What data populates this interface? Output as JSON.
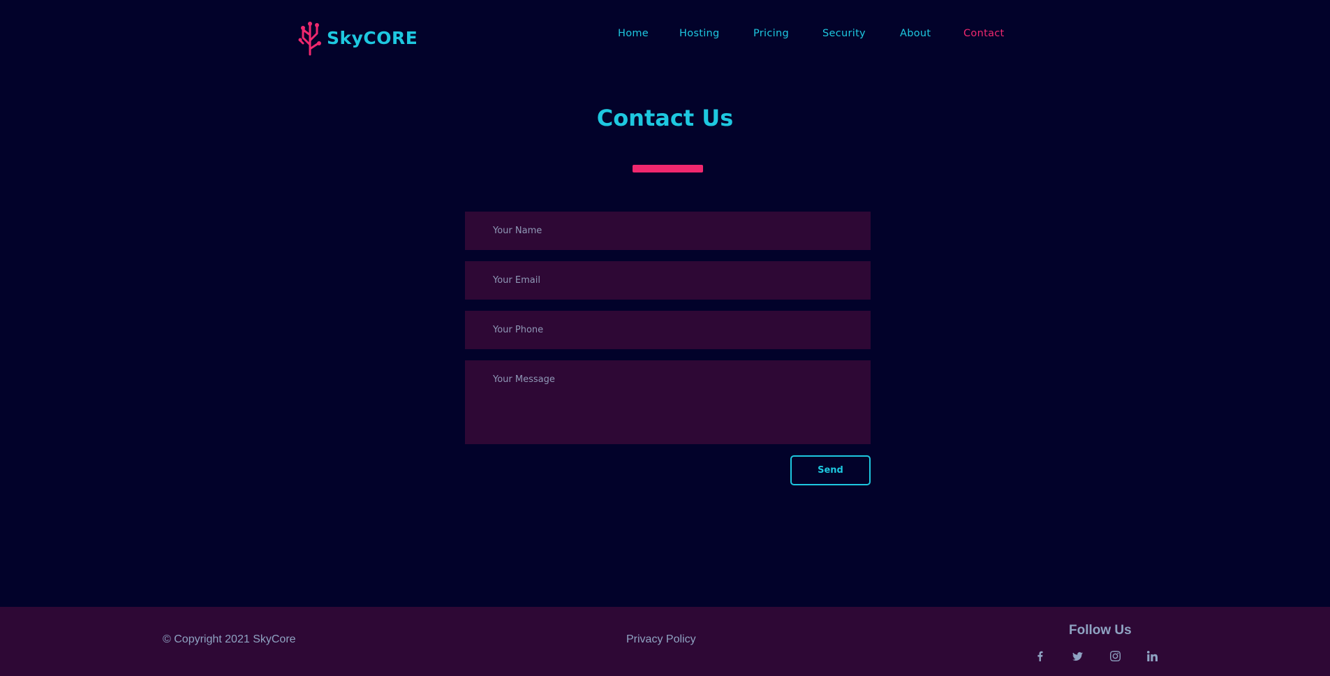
{
  "brand": {
    "name": "SkyCORE",
    "accent": "#1ec8e0",
    "highlight": "#f0286e"
  },
  "nav": {
    "items": [
      {
        "label": "Home",
        "active": false
      },
      {
        "label": "Hosting",
        "active": false
      },
      {
        "label": "Pricing",
        "active": false
      },
      {
        "label": "Security",
        "active": false
      },
      {
        "label": "About",
        "active": false
      },
      {
        "label": "Contact",
        "active": true
      }
    ]
  },
  "contact": {
    "title": "Contact Us",
    "form": {
      "name_placeholder": "Your Name",
      "email_placeholder": "Your Email",
      "phone_placeholder": "Your Phone",
      "message_placeholder": "Your Message",
      "send_label": "Send"
    }
  },
  "footer": {
    "copyright": "© Copyright 2021 SkyCore",
    "privacy_label": "Privacy Policy",
    "follow_title": "Follow Us",
    "social_icons": [
      "facebook-icon",
      "twitter-icon",
      "instagram-icon",
      "linkedin-icon"
    ]
  },
  "colors": {
    "background": "#02022a",
    "panel": "#2e0835",
    "muted_text": "#8fa3c2"
  }
}
